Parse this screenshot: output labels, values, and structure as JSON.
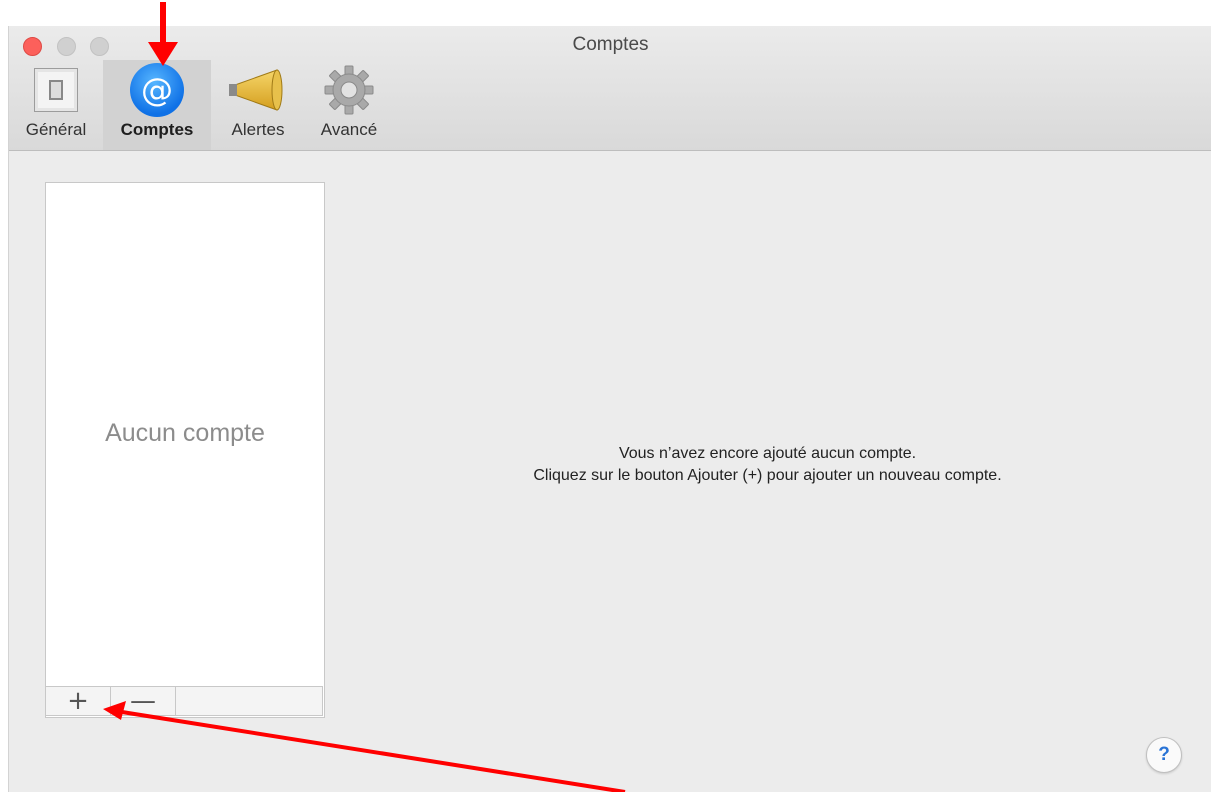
{
  "window": {
    "title": "Comptes"
  },
  "toolbar": {
    "items": [
      {
        "label": "Général",
        "icon": "switch-icon",
        "selected": false
      },
      {
        "label": "Comptes",
        "icon": "at-sign-icon",
        "glyph": "@",
        "selected": true
      },
      {
        "label": "Alertes",
        "icon": "megaphone-icon",
        "selected": false
      },
      {
        "label": "Avancé",
        "icon": "gear-icon",
        "selected": false
      }
    ]
  },
  "accounts": {
    "empty_label": "Aucun compte",
    "add_symbol": "+",
    "remove_symbol": "—"
  },
  "message": {
    "line1": "Vous n’avez encore ajouté aucun compte.",
    "line2": "Cliquez sur le bouton Ajouter (+) pour ajouter un nouveau compte."
  },
  "help": {
    "symbol": "?"
  },
  "colors": {
    "accent": "#0f71e6",
    "annotation_arrow": "#ff0000",
    "close_button": "#fc605b"
  }
}
